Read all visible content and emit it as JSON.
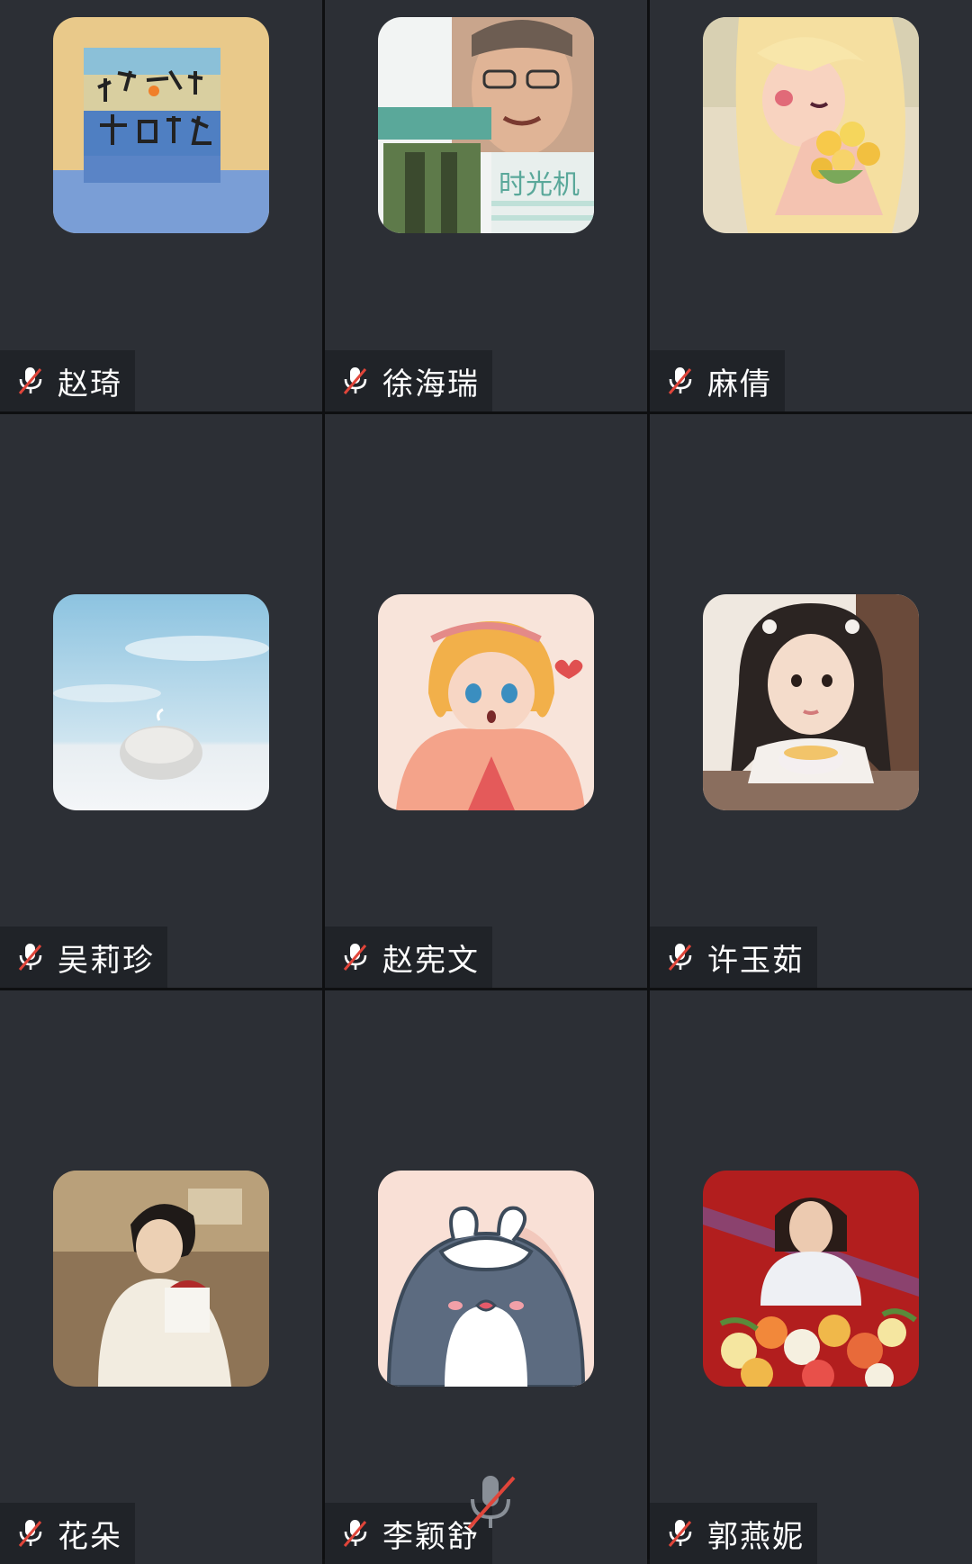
{
  "participants": [
    {
      "name": "赵琦",
      "avatar": "avatar-painting-icon",
      "mic": "muted"
    },
    {
      "name": "徐海瑞",
      "avatar": "avatar-man-photo-icon",
      "mic": "muted",
      "avatar_text": "时光机"
    },
    {
      "name": "麻倩",
      "avatar": "avatar-girl-flowers-icon",
      "mic": "muted"
    },
    {
      "name": "吴莉珍",
      "avatar": "avatar-stone-sky-icon",
      "mic": "muted"
    },
    {
      "name": "赵宪文",
      "avatar": "avatar-cartoon-girl-icon",
      "mic": "muted"
    },
    {
      "name": "许玉茹",
      "avatar": "avatar-child-photo-icon",
      "mic": "muted"
    },
    {
      "name": "花朵",
      "avatar": "avatar-young-man-icon",
      "mic": "muted"
    },
    {
      "name": "李颖舒",
      "avatar": "avatar-penguin-icon",
      "mic": "muted"
    },
    {
      "name": "郭燕妮",
      "avatar": "avatar-girl-bouquet-icon",
      "mic": "muted"
    }
  ],
  "colors": {
    "tile_bg": "#2c2f35",
    "muted_slash": "#e0453a",
    "name_text": "#ffffff"
  }
}
